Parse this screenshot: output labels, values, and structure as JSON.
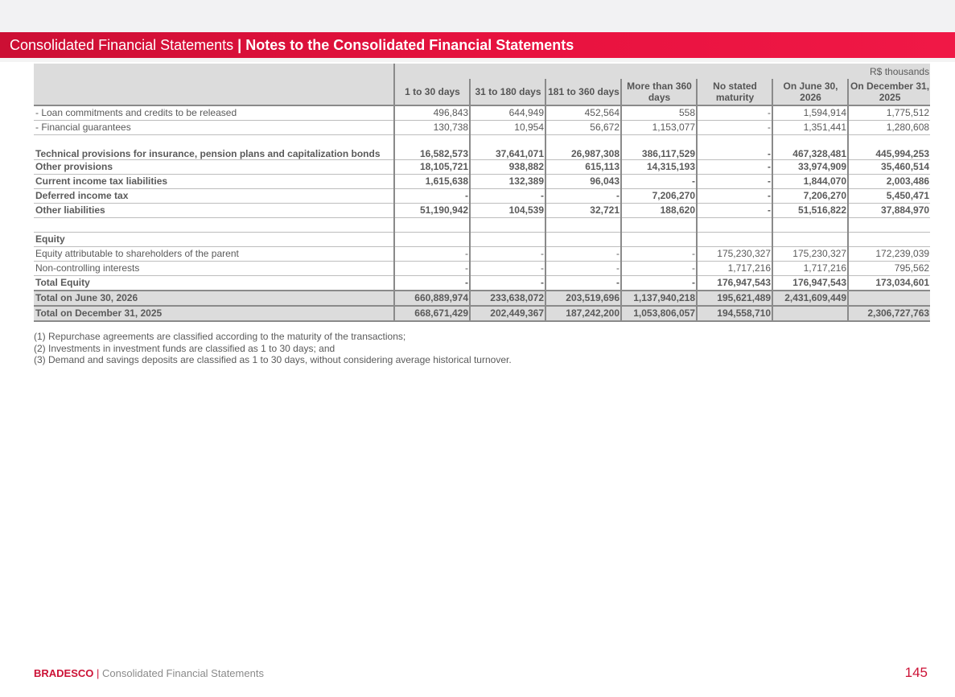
{
  "header": {
    "title_regular": "Consolidated Financial Statements",
    "separator": "|",
    "title_bold": "Notes to the Consolidated Financial Statements"
  },
  "table": {
    "unit": "R$ thousands",
    "columns": [
      "1 to 30 days",
      "31 to 180 days",
      "181 to 360 days",
      "More than 360 days",
      "No stated maturity",
      "On June 30, 2026",
      "On December 31, 2025"
    ],
    "rows": [
      {
        "label": "- Loan commitments and credits to be released",
        "values": [
          "496,843",
          "644,949",
          "452,564",
          "558",
          "-",
          "1,594,914",
          "1,775,512"
        ]
      },
      {
        "label": "- Financial guarantees",
        "values": [
          "130,738",
          "10,954",
          "56,672",
          "1,153,077",
          "-",
          "1,351,441",
          "1,280,608"
        ]
      },
      {
        "label": "Technical provisions for insurance, pension plans and capitalization bonds",
        "values": [
          "16,582,573",
          "37,641,071",
          "26,987,308",
          "386,117,529",
          "-",
          "467,328,481",
          "445,994,253"
        ]
      },
      {
        "label": "Other provisions",
        "values": [
          "18,105,721",
          "938,882",
          "615,113",
          "14,315,193",
          "-",
          "33,974,909",
          "35,460,514"
        ]
      },
      {
        "label": "Current income tax liabilities",
        "values": [
          "1,615,638",
          "132,389",
          "96,043",
          "-",
          "-",
          "1,844,070",
          "2,003,486"
        ]
      },
      {
        "label": "Deferred income tax",
        "values": [
          "-",
          "-",
          "-",
          "7,206,270",
          "-",
          "7,206,270",
          "5,450,471"
        ]
      },
      {
        "label": "Other liabilities",
        "values": [
          "51,190,942",
          "104,539",
          "32,721",
          "188,620",
          "-",
          "51,516,822",
          "37,884,970"
        ]
      },
      {
        "label": "",
        "values": [
          "",
          "",
          "",
          "",
          "",
          "",
          ""
        ]
      },
      {
        "label": "Equity",
        "values": [
          "",
          "",
          "",
          "",
          "",
          "",
          ""
        ]
      },
      {
        "label": "Equity attributable to shareholders of the parent",
        "values": [
          "-",
          "-",
          "-",
          "-",
          "175,230,327",
          "175,230,327",
          "172,239,039"
        ]
      },
      {
        "label": "Non-controlling interests",
        "values": [
          "-",
          "-",
          "-",
          "-",
          "1,717,216",
          "1,717,216",
          "795,562"
        ]
      },
      {
        "label": "Total Equity",
        "values": [
          "-",
          "-",
          "-",
          "-",
          "176,947,543",
          "176,947,543",
          "173,034,601"
        ]
      },
      {
        "label": "Total on June 30, 2026",
        "values": [
          "660,889,974",
          "233,638,072",
          "203,519,696",
          "1,137,940,218",
          "195,621,489",
          "2,431,609,449",
          ""
        ]
      },
      {
        "label": "Total on December 31, 2025",
        "values": [
          "668,671,429",
          "202,449,367",
          "187,242,200",
          "1,053,806,057",
          "194,558,710",
          "",
          "2,306,727,763"
        ]
      }
    ]
  },
  "notes": [
    "(1) Repurchase agreements are classified according to the maturity of the transactions;",
    "(2) Investments in investment funds are classified as 1 to 30 days; and",
    "(3) Demand and savings deposits are classified as 1 to 30 days, without considering average historical turnover."
  ],
  "footer": {
    "brand": "BRADESCO",
    "separator": "|",
    "text": "Consolidated Financial Statements",
    "page_number": "145"
  },
  "colors": {
    "brand_red": "#cc1236",
    "banner_red": "#e8123f",
    "header_gray": "#dcdcdc"
  }
}
